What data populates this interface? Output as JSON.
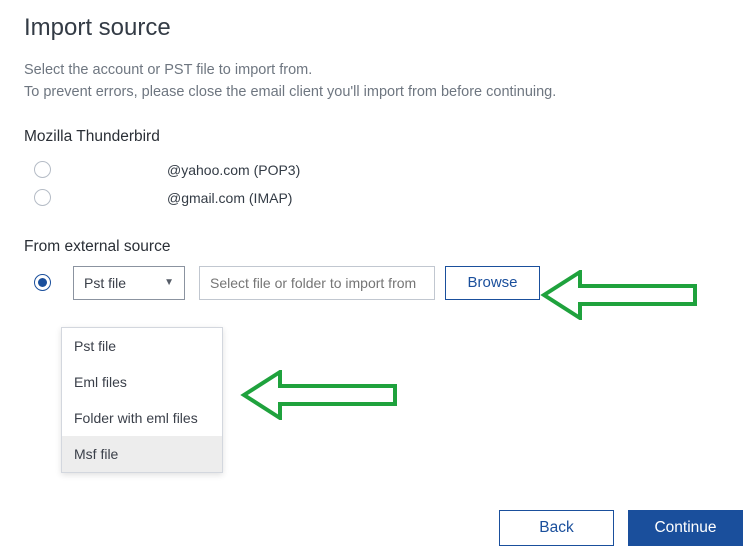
{
  "title": "Import source",
  "description_line1": "Select the account or PST file to import from.",
  "description_line2": "To prevent errors, please close the email client you'll import from before continuing.",
  "thunderbird_heading": "Mozilla Thunderbird",
  "accounts": [
    {
      "label": "@yahoo.com  (POP3)"
    },
    {
      "label": "@gmail.com  (IMAP)"
    }
  ],
  "external_heading": "From external source",
  "filetype_selected": "Pst file",
  "path_placeholder": "Select file or folder to import from",
  "browse_label": "Browse",
  "dropdown": {
    "items": [
      "Pst file",
      "Eml files",
      "Folder with eml files",
      "Msf file"
    ],
    "highlight_index": 3
  },
  "buttons": {
    "back": "Back",
    "continue": "Continue"
  },
  "arrow_color": "#1fa23d"
}
